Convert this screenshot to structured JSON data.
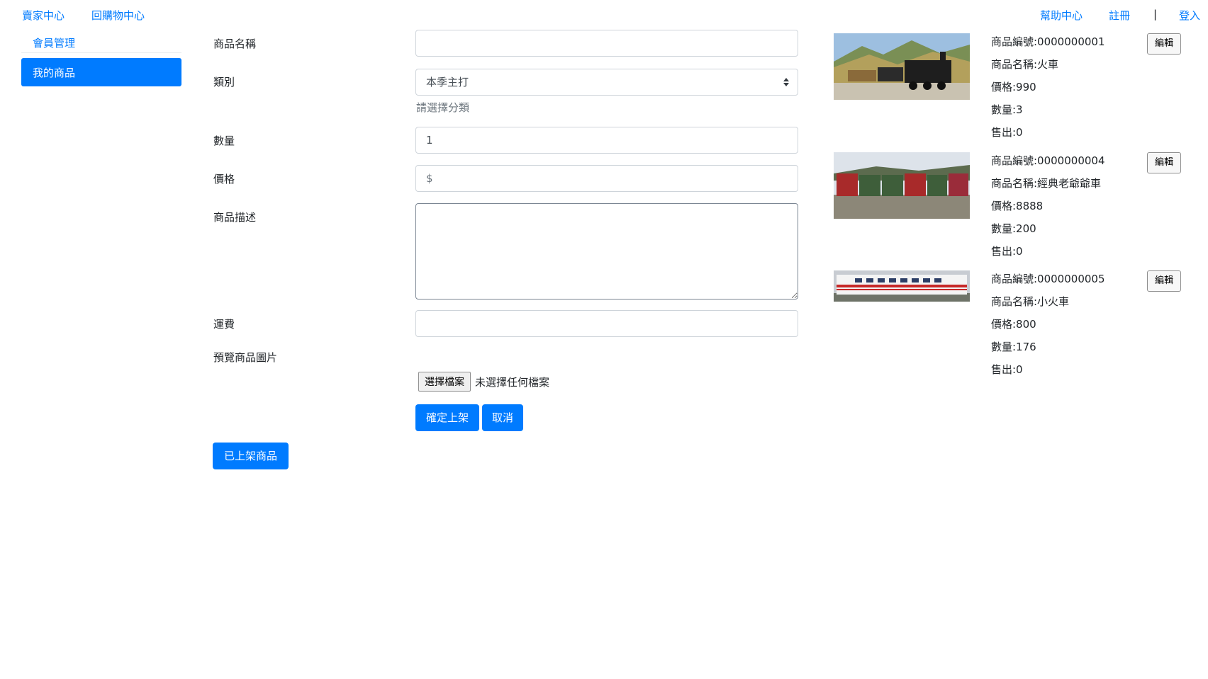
{
  "topnav": {
    "seller_center": "賣家中心",
    "shopping_center": "回購物中心",
    "help_center": "幫助中心",
    "register": "註冊",
    "separator": "|",
    "login": "登入"
  },
  "sidebar": {
    "member_management": "會員管理",
    "my_products": "我的商品"
  },
  "form": {
    "name_label": "商品名稱",
    "name_value": "",
    "category_label": "類別",
    "category_value": "本季主打",
    "category_help": "請選擇分類",
    "quantity_label": "數量",
    "quantity_value": "1",
    "price_label": "價格",
    "price_placeholder": "$",
    "description_label": "商品描述",
    "description_value": "",
    "shipping_label": "運費",
    "shipping_value": "",
    "preview_label": "預覽商品圖片",
    "file_button": "選擇檔案",
    "file_status": "未選擇任何檔案",
    "submit_button": "確定上架",
    "cancel_button": "取消",
    "listed_button": "已上架商品"
  },
  "products": [
    {
      "id": "商品編號:0000000001",
      "name": "商品名稱:火車",
      "price": "價格:990",
      "quantity": "數量:3",
      "sold": "售出:0",
      "edit": "編輯"
    },
    {
      "id": "商品編號:0000000004",
      "name": "商品名稱:經典老爺爺車",
      "price": "價格:8888",
      "quantity": "數量:200",
      "sold": "售出:0",
      "edit": "編輯"
    },
    {
      "id": "商品編號:0000000005",
      "name": "商品名稱:小火車",
      "price": "價格:800",
      "quantity": "數量:176",
      "sold": "售出:0",
      "edit": "編輯"
    }
  ],
  "colors": {
    "primary": "#007bff",
    "text": "#212529",
    "muted": "#6c757d",
    "border": "#ced4da"
  }
}
